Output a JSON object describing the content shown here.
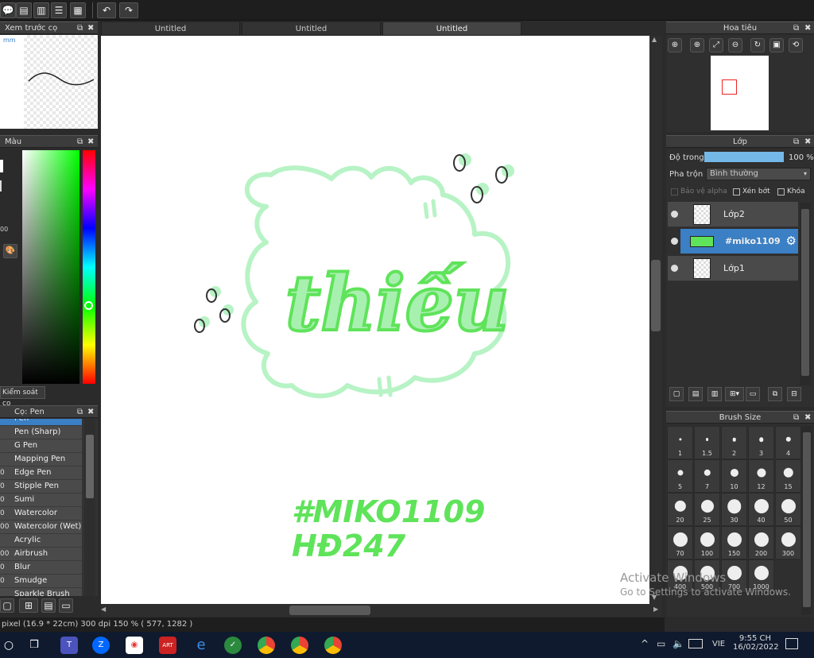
{
  "tabs": [
    "Untitled",
    "Untitled",
    "Untitled"
  ],
  "panels": {
    "preview_title": "Xem trước cọ",
    "preview_size": "mm",
    "color_title": "Màu",
    "color_val": "00",
    "brush_control": "Kiểm soát cọ",
    "brush_title": "Cọ: Pen",
    "navigator_title": "Hoa tiêu",
    "layer_title": "Lớp",
    "brushsize_title": "Brush Size"
  },
  "layer": {
    "opacity_label": "Độ trong",
    "opacity_value": "100 %",
    "opacity": 1.0,
    "blend_label": "Pha trộn",
    "blend_value": "Bình thường",
    "protect_alpha": "Bảo vệ alpha",
    "clip": "Xén bớt",
    "lock": "Khóa",
    "layers": [
      {
        "name": "Lớp2",
        "selected": false
      },
      {
        "name": "#miko1109",
        "selected": true
      },
      {
        "name": "Lớp1",
        "selected": false
      }
    ]
  },
  "brushes": [
    {
      "num": "",
      "name": "Pen"
    },
    {
      "num": "",
      "name": "Pen (Sharp)"
    },
    {
      "num": "",
      "name": "G Pen"
    },
    {
      "num": "",
      "name": "Mapping Pen"
    },
    {
      "num": "0",
      "name": "Edge Pen"
    },
    {
      "num": "0",
      "name": "Stipple Pen"
    },
    {
      "num": "0",
      "name": "Sumi"
    },
    {
      "num": "0",
      "name": "Watercolor"
    },
    {
      "num": "00",
      "name": "Watercolor (Wet)"
    },
    {
      "num": "",
      "name": "Acrylic"
    },
    {
      "num": "00",
      "name": "Airbrush"
    },
    {
      "num": "0",
      "name": "Blur"
    },
    {
      "num": "0",
      "name": "Smudge"
    },
    {
      "num": "",
      "name": "Sparkle Brush"
    }
  ],
  "brush_sizes": [
    "1",
    "1.5",
    "2",
    "3",
    "4",
    "5",
    "7",
    "10",
    "12",
    "15",
    "20",
    "25",
    "30",
    "40",
    "50",
    "70",
    "100",
    "150",
    "200",
    "300",
    "400",
    "500",
    "700",
    "1000"
  ],
  "artwork": {
    "word": "thiếu",
    "tag1": "#MIKO1109",
    "tag2": "HĐ247"
  },
  "status": "pixel  (16.9 * 22cm)  300 dpi  150 %  ( 577, 1282 )",
  "watermark": {
    "line1": "Activate Windows",
    "line2": "Go to Settings to activate Windows."
  },
  "taskbar": {
    "lang": "VIE",
    "time": "9:55 CH",
    "date": "16/02/2022"
  },
  "colors": {
    "accent": "#3b7fc4",
    "green": "#5fe35a",
    "mint": "#b7f3c5"
  }
}
